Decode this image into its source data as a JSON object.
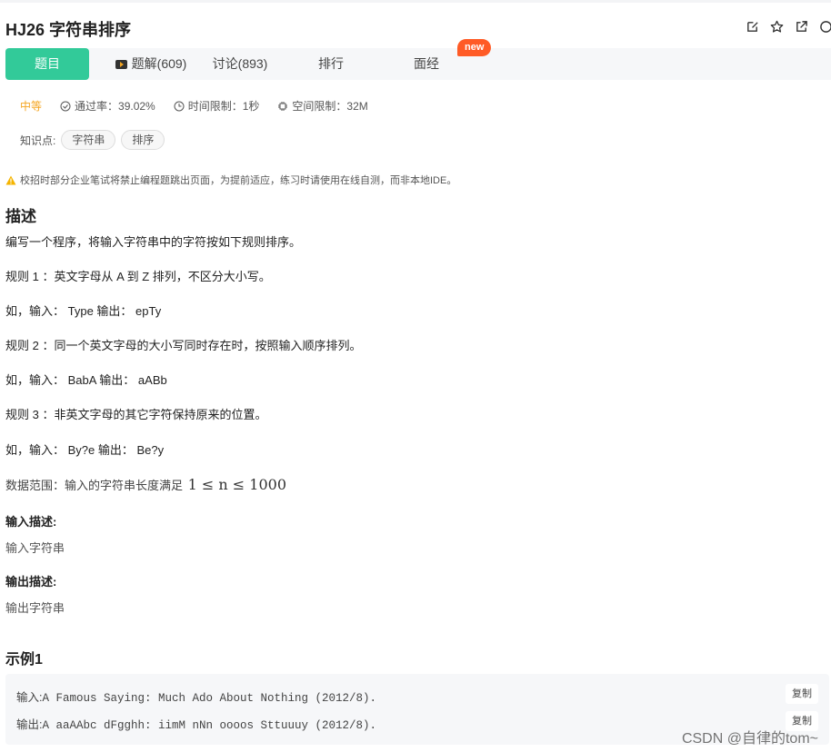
{
  "problem": {
    "title": "HJ26  字符串排序"
  },
  "tabs": [
    {
      "label": "题目",
      "active": true
    },
    {
      "label": "题解(609)",
      "icon": "video-icon"
    },
    {
      "label": "讨论(893)"
    },
    {
      "label": "排行"
    },
    {
      "label": "面经"
    }
  ],
  "new_badge": "new",
  "meta": {
    "difficulty": "中等",
    "pass_rate": "通过率：39.02%",
    "time_limit": "时间限制：1秒",
    "space_limit": "空间限制：32M"
  },
  "knowledge": {
    "label": "知识点:",
    "tags": [
      "字符串",
      "排序"
    ]
  },
  "notice": "校招时部分企业笔试将禁止编程题跳出页面，为提前适应，练习时请使用在线自测，而非本地IDE。",
  "description": {
    "heading": "描述",
    "lines": [
      "编写一个程序，将输入字符串中的字符按如下规则排序。",
      "规则 1 ：英文字母从 A 到 Z 排列，不区分大小写。",
      "如，输入： Type 输出： epTy",
      "规则 2 ：同一个英文字母的大小写同时存在时，按照输入顺序排列。",
      "如，输入： BabA 输出： aABb",
      "规则 3 ：非英文字母的其它字符保持原来的位置。",
      "如，输入： By?e 输出： Be?y"
    ],
    "range_label": "数据范围：输入的字符串长度满足",
    "range_math": "1 ≤ n ≤ 1000"
  },
  "input_desc": {
    "heading": "输入描述:",
    "text": "输入字符串"
  },
  "output_desc": {
    "heading": "输出描述:",
    "text": "输出字符串"
  },
  "example": {
    "heading": "示例1",
    "input_label": "输入:",
    "input_value": "A Famous Saying: Much Ado About Nothing (2012/8).",
    "output_label": "输出:",
    "output_value": "A aaAAbc dFgghh: iimM nNn oooos Sttuuuy (2012/8).",
    "copy_label": "复制"
  },
  "watermark": "CSDN @自律的tom~",
  "colors": {
    "accent": "#32ca99",
    "difficulty": "#f5a623",
    "new_badge": "#ff5b26"
  }
}
